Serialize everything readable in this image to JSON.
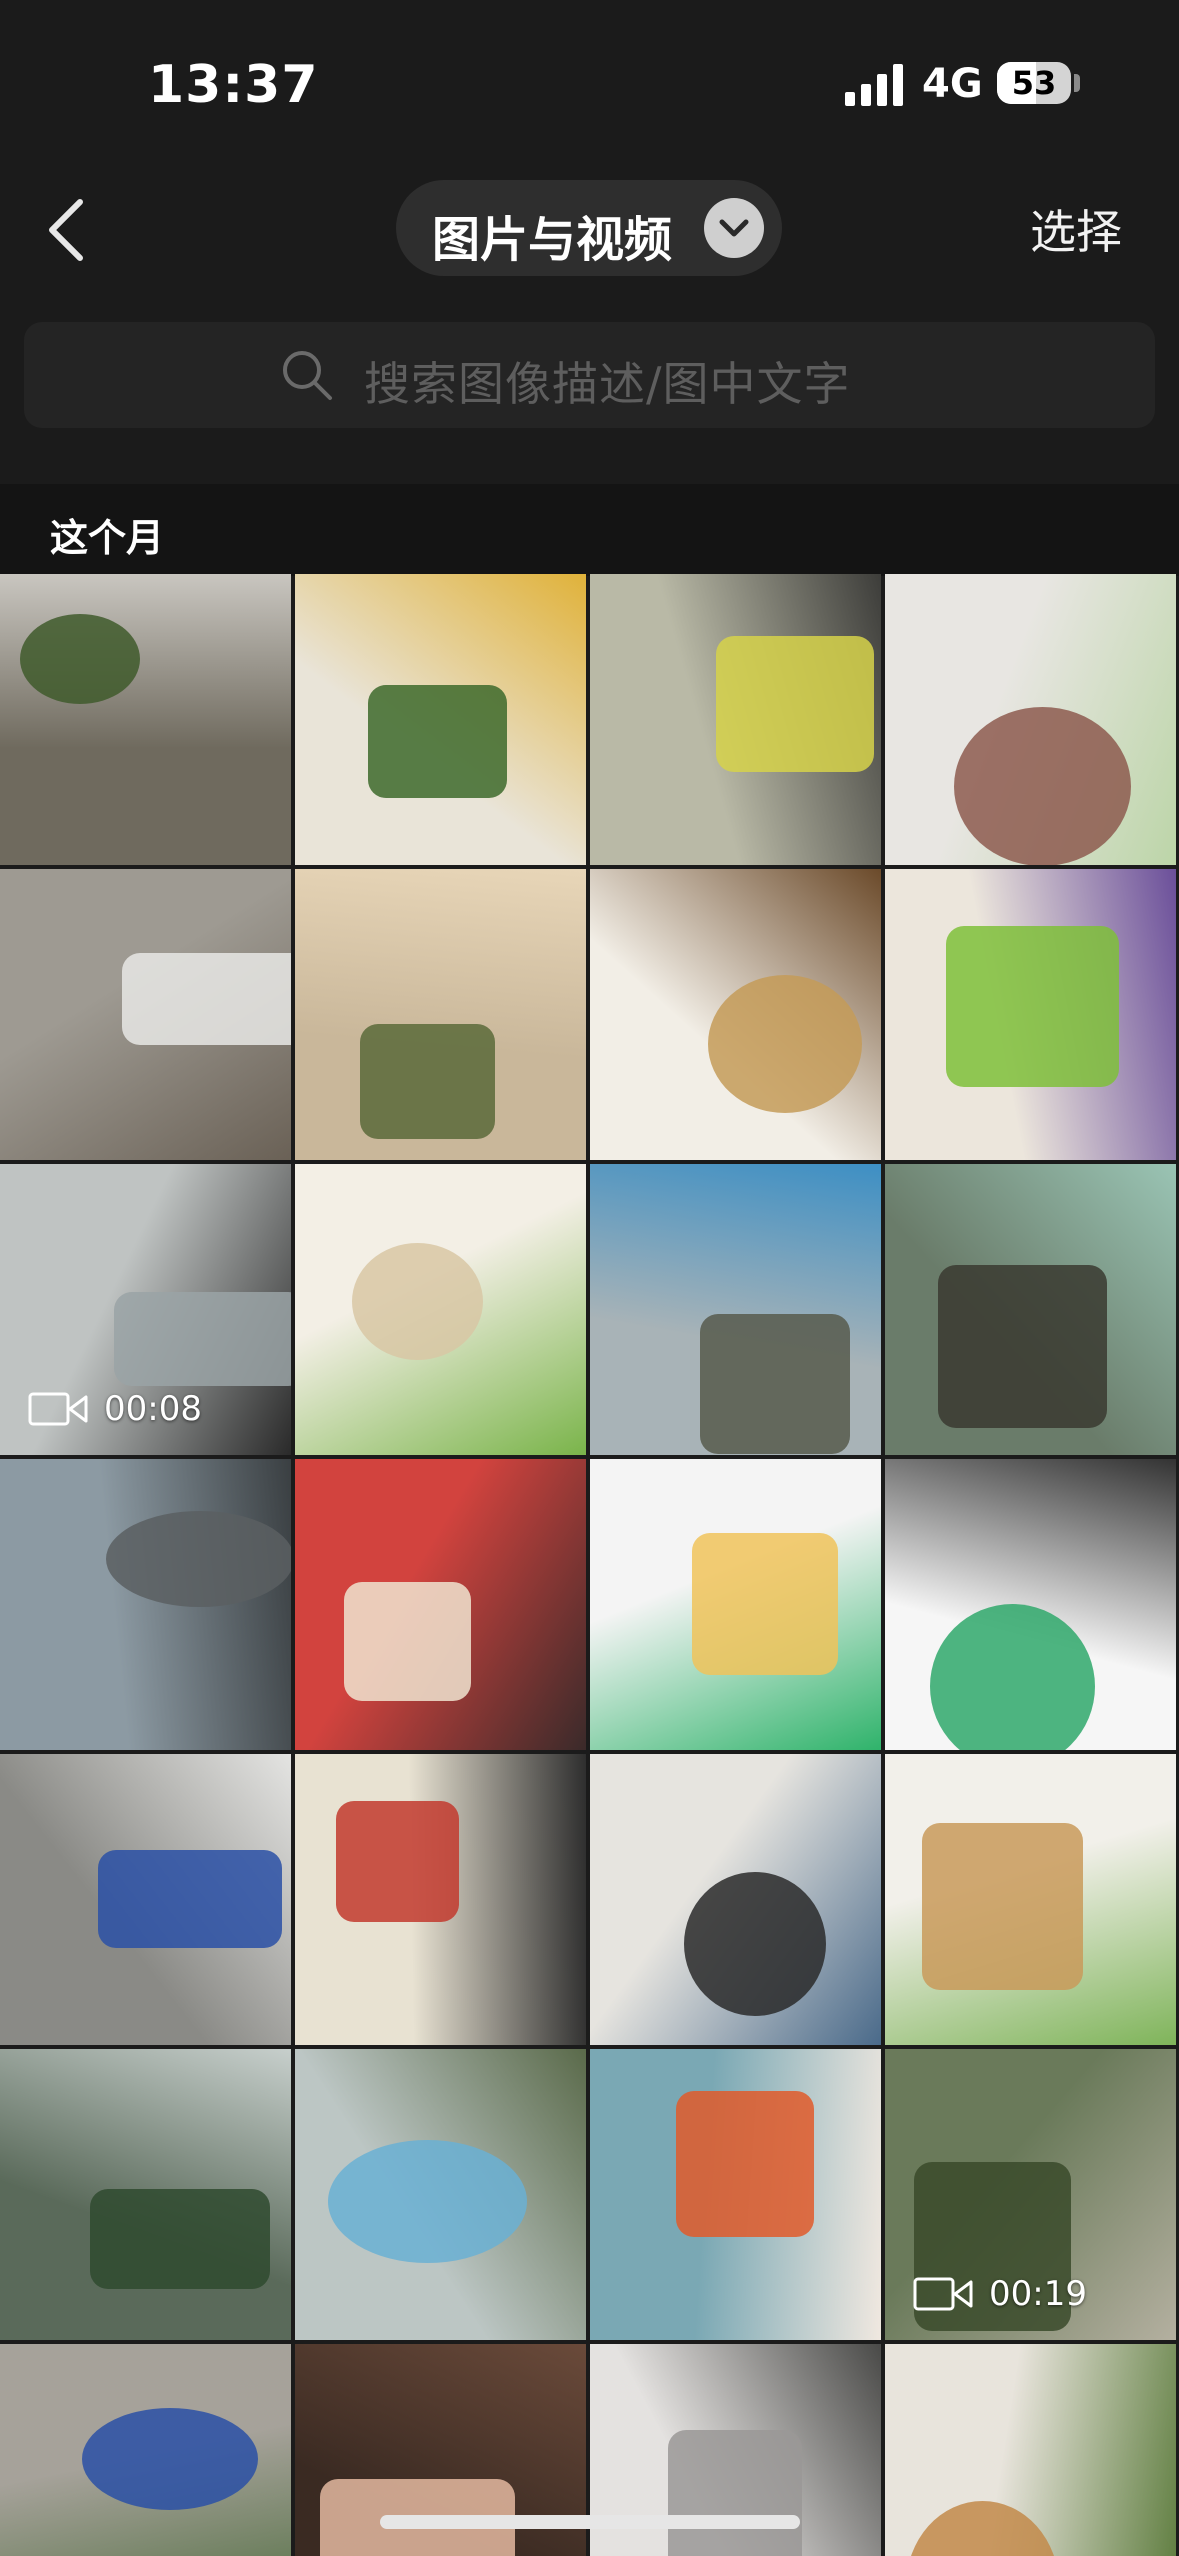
{
  "status_bar": {
    "time": "13:37",
    "network": "4G",
    "battery_level": "53",
    "battery_fraction": 0.53
  },
  "nav": {
    "back_icon": "chevron-left-icon",
    "title": "图片与视频",
    "title_dropdown_icon": "chevron-down-icon",
    "select_label": "选择"
  },
  "search": {
    "icon": "search-icon",
    "placeholder": "搜索图像描述/图中文字"
  },
  "section": {
    "title": "这个月"
  },
  "grid": {
    "tiles": [
      {
        "desc": "blurry-outdoor",
        "colors": [
          "#6f6a5e",
          "#3f5a2c",
          "#c9c6c0"
        ],
        "video": null
      },
      {
        "desc": "groceries-cucumbers",
        "colors": [
          "#e9e4d8",
          "#3d6a2c",
          "#e0b23a"
        ],
        "video": null
      },
      {
        "desc": "plastic-bag-fruit",
        "colors": [
          "#b9b9a6",
          "#d6d24a",
          "#3d3d3a"
        ],
        "video": null
      },
      {
        "desc": "room-corner-stand",
        "colors": [
          "#e8e6e2",
          "#8d5b4f",
          "#bcd5a8"
        ],
        "video": null
      },
      {
        "desc": "wall-floor-corner",
        "colors": [
          "#9e9a92",
          "#e8e8e5",
          "#6a6156"
        ],
        "video": null
      },
      {
        "desc": "meal-tablet-table",
        "colors": [
          "#c9b79a",
          "#5a6a3a",
          "#e8d6b8"
        ],
        "video": null
      },
      {
        "desc": "noodle-bowl",
        "colors": [
          "#f2eee6",
          "#c49b58",
          "#6b4a2a"
        ],
        "video": null
      },
      {
        "desc": "breakfast-tray",
        "colors": [
          "#ece6dc",
          "#7fbf3a",
          "#6b4f9a"
        ],
        "video": null
      },
      {
        "desc": "granite-floor-video",
        "colors": [
          "#bfc3c2",
          "#9aa3a6",
          "#2a2a2a"
        ],
        "video": "00:08"
      },
      {
        "desc": "dumplings-bowl",
        "colors": [
          "#f3efe5",
          "#d8c7a4",
          "#7ab44a"
        ],
        "video": null
      },
      {
        "desc": "desk-food-tablet",
        "colors": [
          "#a8b3b7",
          "#575a4c",
          "#3d8fc4"
        ],
        "video": null
      },
      {
        "desc": "dinner-table-tv",
        "colors": [
          "#6a7c6a",
          "#3a3a30",
          "#9ac4b4"
        ],
        "video": null
      },
      {
        "desc": "rainy-road-windshield",
        "colors": [
          "#8c9aa3",
          "#5a5f62",
          "#3a3f42"
        ],
        "video": null
      },
      {
        "desc": "stage-flowers-event",
        "colors": [
          "#d2433e",
          "#f0e4d0",
          "#3a2a2a"
        ],
        "video": null
      },
      {
        "desc": "app-screenshot-services",
        "colors": [
          "#f4f4f4",
          "#f0c35a",
          "#2fb36b"
        ],
        "video": null
      },
      {
        "desc": "parking-app-screenshot",
        "colors": [
          "#f6f6f6",
          "#2fa86b",
          "#333333"
        ],
        "video": null
      },
      {
        "desc": "parking-lot-cars",
        "colors": [
          "#8a8a86",
          "#2a50a6",
          "#e4e4e2"
        ],
        "video": null
      },
      {
        "desc": "school-group-photo",
        "colors": [
          "#e8e2d2",
          "#c23a2e",
          "#2e2e2e"
        ],
        "video": null
      },
      {
        "desc": "classroom-people",
        "colors": [
          "#e6e4df",
          "#2a2a2a",
          "#4a6a8a"
        ],
        "video": null
      },
      {
        "desc": "noodle-plate",
        "colors": [
          "#f2f0ea",
          "#c99a5a",
          "#7fb45a"
        ],
        "video": null
      },
      {
        "desc": "forest-road",
        "colors": [
          "#5a6a5a",
          "#2f4a2f",
          "#c7cfcc"
        ],
        "video": null
      },
      {
        "desc": "raincoat-mountain",
        "colors": [
          "#bcc6c4",
          "#6ab0d4",
          "#5a6a4a"
        ],
        "video": null
      },
      {
        "desc": "helmet-selfie",
        "colors": [
          "#7aa8b4",
          "#e05a2a",
          "#f0e8e0"
        ],
        "video": null
      },
      {
        "desc": "bamboo-path-video",
        "colors": [
          "#6a7a5a",
          "#3a4a2a",
          "#b4b0a0"
        ],
        "video": "00:19"
      },
      {
        "desc": "parking-lot-cars-2",
        "colors": [
          "#a6a29a",
          "#2a50a6",
          "#4a6a3a"
        ],
        "video": null
      },
      {
        "desc": "friends-selfie",
        "colors": [
          "#3a2a22",
          "#e4b8a0",
          "#6a4a3a"
        ],
        "video": null
      },
      {
        "desc": "white-cat-closeup",
        "colors": [
          "#e4e2e0",
          "#9a9896",
          "#4a4a48"
        ],
        "video": null
      },
      {
        "desc": "noodle-bowl-chopsticks",
        "colors": [
          "#e8e4dc",
          "#c28a4a",
          "#5a7a3a"
        ],
        "video": null
      }
    ]
  },
  "video_icon": "video-camera-icon"
}
